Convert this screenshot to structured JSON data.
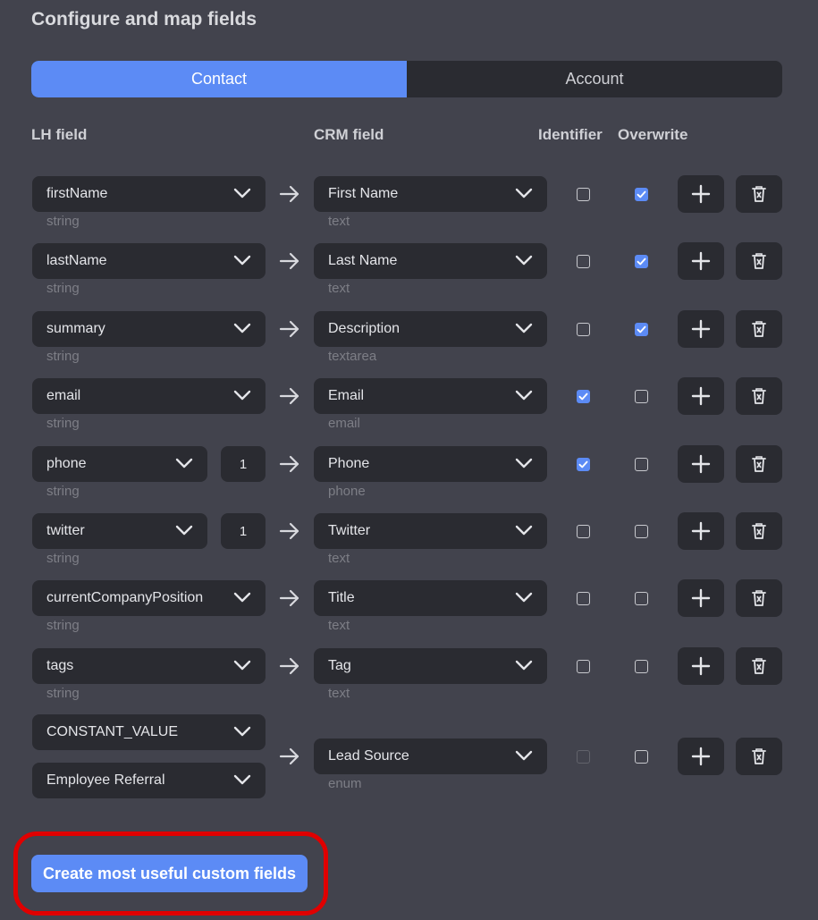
{
  "page": {
    "title": "Configure and map fields"
  },
  "tabs": [
    {
      "label": "Contact",
      "active": true
    },
    {
      "label": "Account",
      "active": false
    }
  ],
  "columns": {
    "lh": "LH field",
    "crm": "CRM field",
    "identifier": "Identifier",
    "overwrite": "Overwrite"
  },
  "rows": [
    {
      "lh": "firstName",
      "lh_type": "string",
      "crm": "First Name",
      "crm_type": "text",
      "identifier": false,
      "overwrite": true
    },
    {
      "lh": "lastName",
      "lh_type": "string",
      "crm": "Last Name",
      "crm_type": "text",
      "identifier": false,
      "overwrite": true
    },
    {
      "lh": "summary",
      "lh_type": "string",
      "crm": "Description",
      "crm_type": "textarea",
      "identifier": false,
      "overwrite": true
    },
    {
      "lh": "email",
      "lh_type": "string",
      "crm": "Email",
      "crm_type": "email",
      "identifier": true,
      "overwrite": false
    },
    {
      "lh": "phone",
      "lh_type": "string",
      "index": "1",
      "crm": "Phone",
      "crm_type": "phone",
      "identifier": true,
      "overwrite": false
    },
    {
      "lh": "twitter",
      "lh_type": "string",
      "index": "1",
      "crm": "Twitter",
      "crm_type": "text",
      "identifier": false,
      "overwrite": false
    },
    {
      "lh": "currentCompanyPosition",
      "lh_type": "string",
      "crm": "Title",
      "crm_type": "text",
      "identifier": false,
      "overwrite": false
    },
    {
      "lh": "tags",
      "lh_type": "string",
      "crm": "Tag",
      "crm_type": "text",
      "identifier": false,
      "overwrite": false
    }
  ],
  "constant_row": {
    "lh": "CONSTANT_VALUE",
    "value": "Employee Referral",
    "crm": "Lead Source",
    "crm_type": "enum",
    "identifier": false,
    "identifier_disabled": true,
    "overwrite": false
  },
  "cta": {
    "label": "Create most useful custom fields"
  },
  "icons": {
    "chevron": "chevron-down-icon",
    "arrow": "arrow-right-icon",
    "add": "plus-icon",
    "delete": "trash-icon"
  },
  "colors": {
    "accent": "#5c8bf5",
    "background": "#42434d",
    "control": "#2a2b31",
    "highlight": "#e00000"
  }
}
